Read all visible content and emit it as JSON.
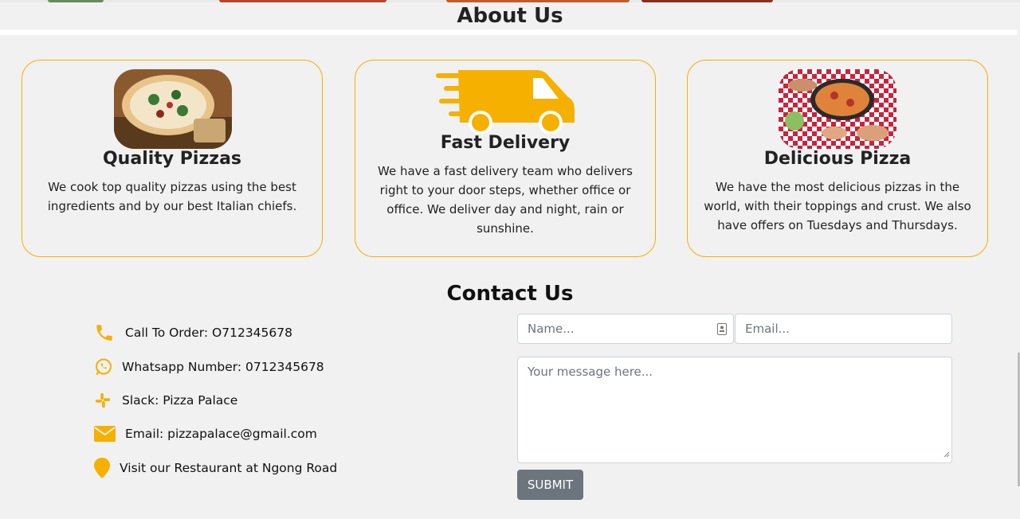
{
  "about": {
    "title": "About Us",
    "cards": [
      {
        "title": "Quality Pizzas",
        "text": "We cook top quality pizzas using the best ingredients and by our best Italian chiefs."
      },
      {
        "title": "Fast Delivery",
        "text": "We have a fast delivery team who delivers right to your door steps, whether office or office. We deliver day and night, rain or sunshine."
      },
      {
        "title": "Delicious Pizza",
        "text": "We have the most delicious pizzas in the world, with their toppings and crust. We also have offers on Tuesdays and Thursdays."
      }
    ]
  },
  "contact": {
    "title": "Contact Us",
    "info": [
      {
        "icon": "phone-icon",
        "text": "Call To Order: O712345678"
      },
      {
        "icon": "whatsapp-icon",
        "text": "Whatsapp Number: 0712345678"
      },
      {
        "icon": "slack-icon",
        "text": "Slack: Pizza Palace"
      },
      {
        "icon": "envelope-icon",
        "text": "Email: pizzapalace@gmail.com"
      },
      {
        "icon": "map-pin-icon",
        "text": "Visit our Restaurant at Ngong Road"
      }
    ],
    "form": {
      "name_placeholder": "Name...",
      "email_placeholder": "Email...",
      "message_placeholder": "Your message here...",
      "submit_label": "SUBMIT"
    }
  },
  "colors": {
    "accent": "#f5b000",
    "background": "#f1f1f1",
    "button": "#6c757d"
  }
}
